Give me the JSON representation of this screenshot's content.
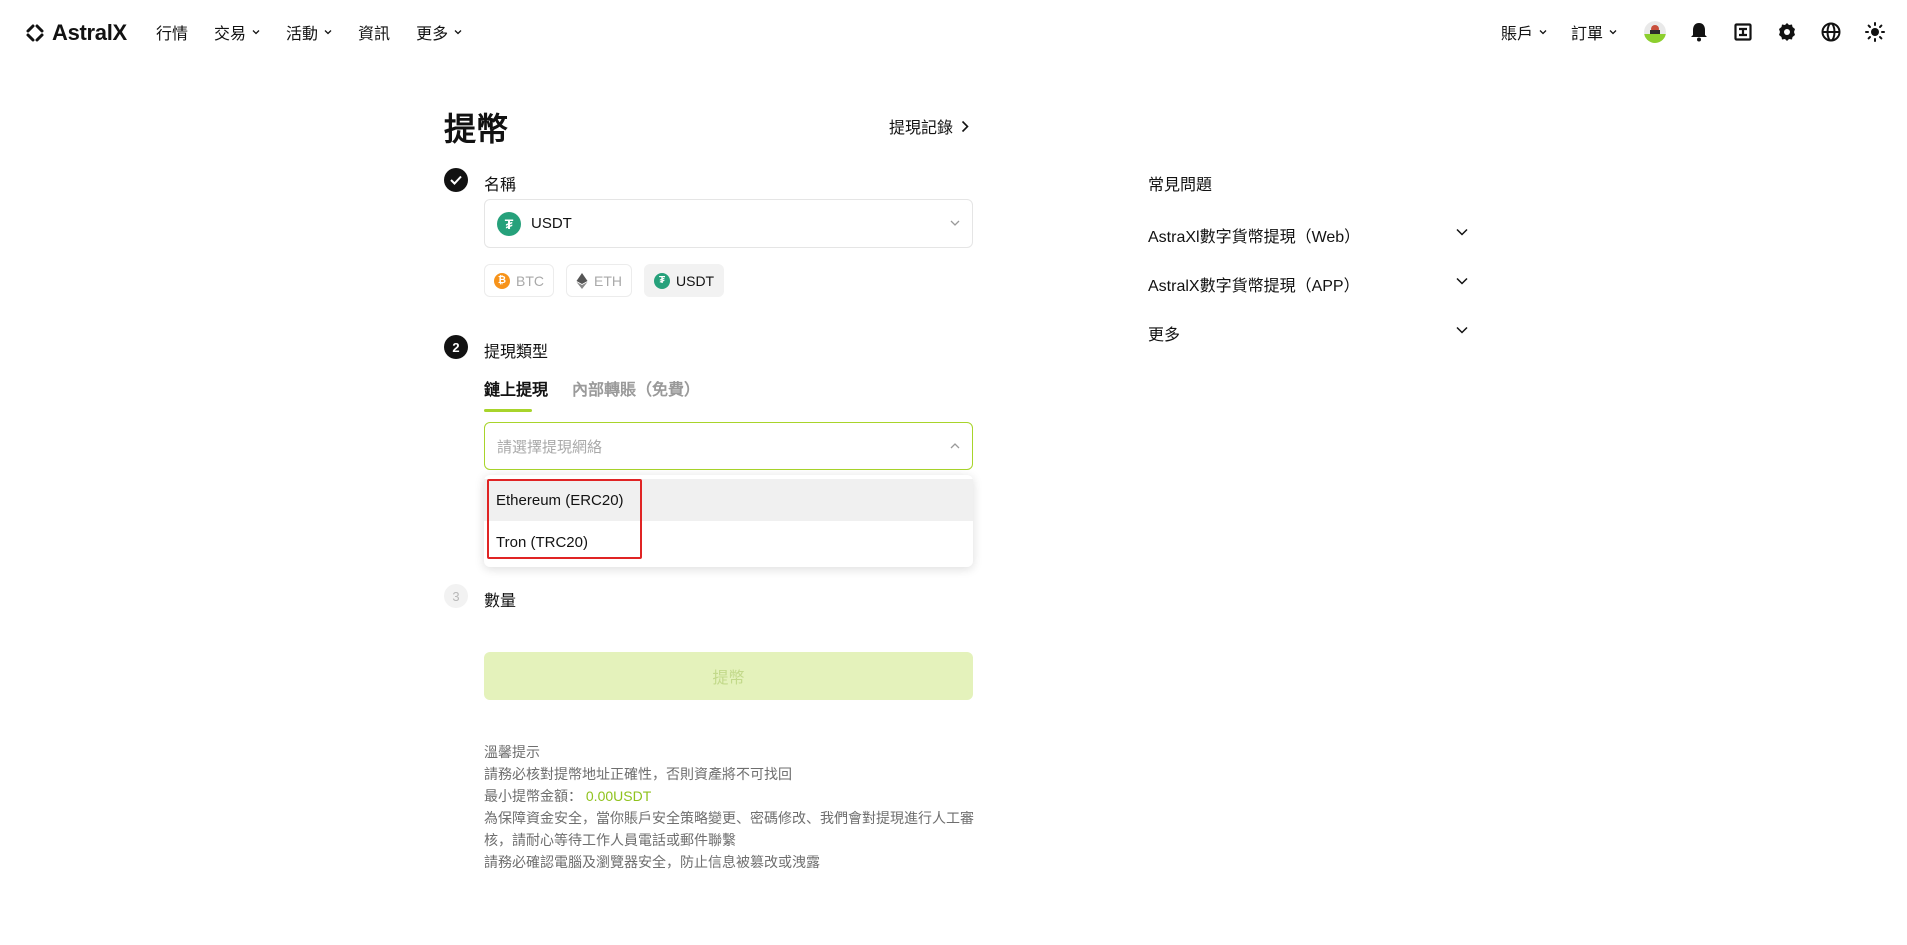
{
  "nav": {
    "logo_text": "AstralX",
    "left_items": [
      {
        "label": "行情",
        "has_dropdown": false
      },
      {
        "label": "交易",
        "has_dropdown": true
      },
      {
        "label": "活動",
        "has_dropdown": true
      },
      {
        "label": "資訊",
        "has_dropdown": false
      },
      {
        "label": "更多",
        "has_dropdown": true
      }
    ],
    "account_label": "賬戶",
    "orders_label": "訂單",
    "right_icons": [
      "avatar-icon",
      "bell-icon",
      "download-icon",
      "gear-icon",
      "globe-icon",
      "sun-icon"
    ]
  },
  "page": {
    "title": "提幣",
    "history_link": "提現記錄"
  },
  "steps": {
    "step1_label": "名稱",
    "step2_number": "2",
    "step2_label": "提現類型",
    "step3_number": "3",
    "step3_label": "數量"
  },
  "coin_select": {
    "selected": "USDT",
    "icon": "tether-icon"
  },
  "quick_coins": [
    {
      "label": "BTC",
      "color": "#f7931a",
      "selected": false
    },
    {
      "label": "ETH",
      "color": "#627eea",
      "selected": false
    },
    {
      "label": "USDT",
      "color": "#26a17b",
      "selected": true
    }
  ],
  "withdraw_tabs": {
    "onchain": "鏈上提現",
    "internal": "內部轉賬（免費）"
  },
  "network_select": {
    "placeholder": "請選擇提現網絡",
    "options": [
      "Ethereum (ERC20)",
      "Tron (TRC20)"
    ]
  },
  "submit_label": "提幣",
  "tips": {
    "title": "溫馨提示",
    "line1": "請務必核對提幣地址正確性，否則資產將不可找回",
    "min_label": "最小提幣金額：",
    "min_value": "0.00USDT",
    "line3": "為保障資金安全，當你賬戶安全策略變更、密碼修改、我們會對提現進行人工審核，請耐心等待工作人員電話或郵件聯繫",
    "line4": "請務必確認電腦及瀏覽器安全，防止信息被篡改或洩露"
  },
  "faq": {
    "title": "常見問題",
    "items": [
      "AstraXl數字貨幣提現（Web）",
      "AstralX數字貨幣提現（APP）",
      "更多"
    ]
  },
  "colors": {
    "accent": "#a8d42b",
    "submit_disabled_bg": "#e4f2bb",
    "highlight": "#e02424"
  }
}
